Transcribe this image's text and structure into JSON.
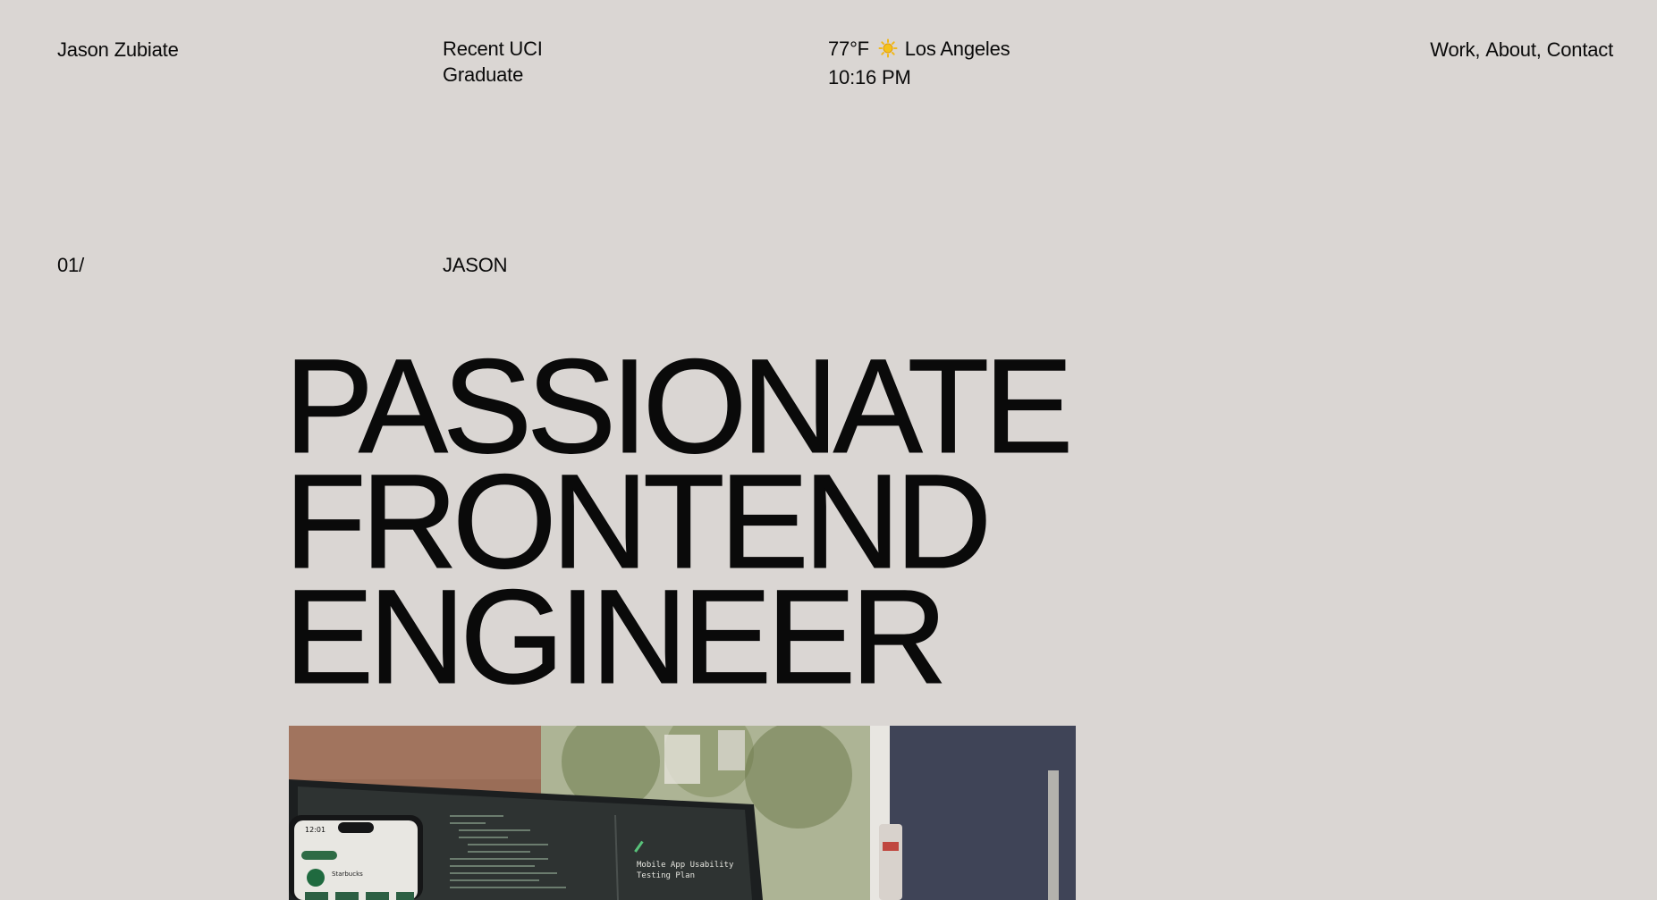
{
  "header": {
    "site_name": "Jason Zubiate",
    "status_line1": "Recent UCI",
    "status_line2": "Graduate",
    "weather": {
      "temperature": "77°F",
      "icon": "sun-icon",
      "city": "Los Angeles",
      "time": "10:16 PM"
    },
    "nav": [
      {
        "label": "Work"
      },
      {
        "label": "About"
      },
      {
        "label": "Contact"
      }
    ]
  },
  "section": {
    "number": "01/",
    "label": "JASON"
  },
  "hero": {
    "line1": "PASSIONATE",
    "line2": "FRONTEND",
    "line3": "ENGINEER"
  },
  "photo": {
    "phone_time": "12:01",
    "phone_app": "Starbucks",
    "screen_note_line1": "Mobile App Usability",
    "screen_note_line2": "Testing Plan"
  },
  "colors": {
    "background": "#dad6d3",
    "text": "#0a0a0a"
  }
}
